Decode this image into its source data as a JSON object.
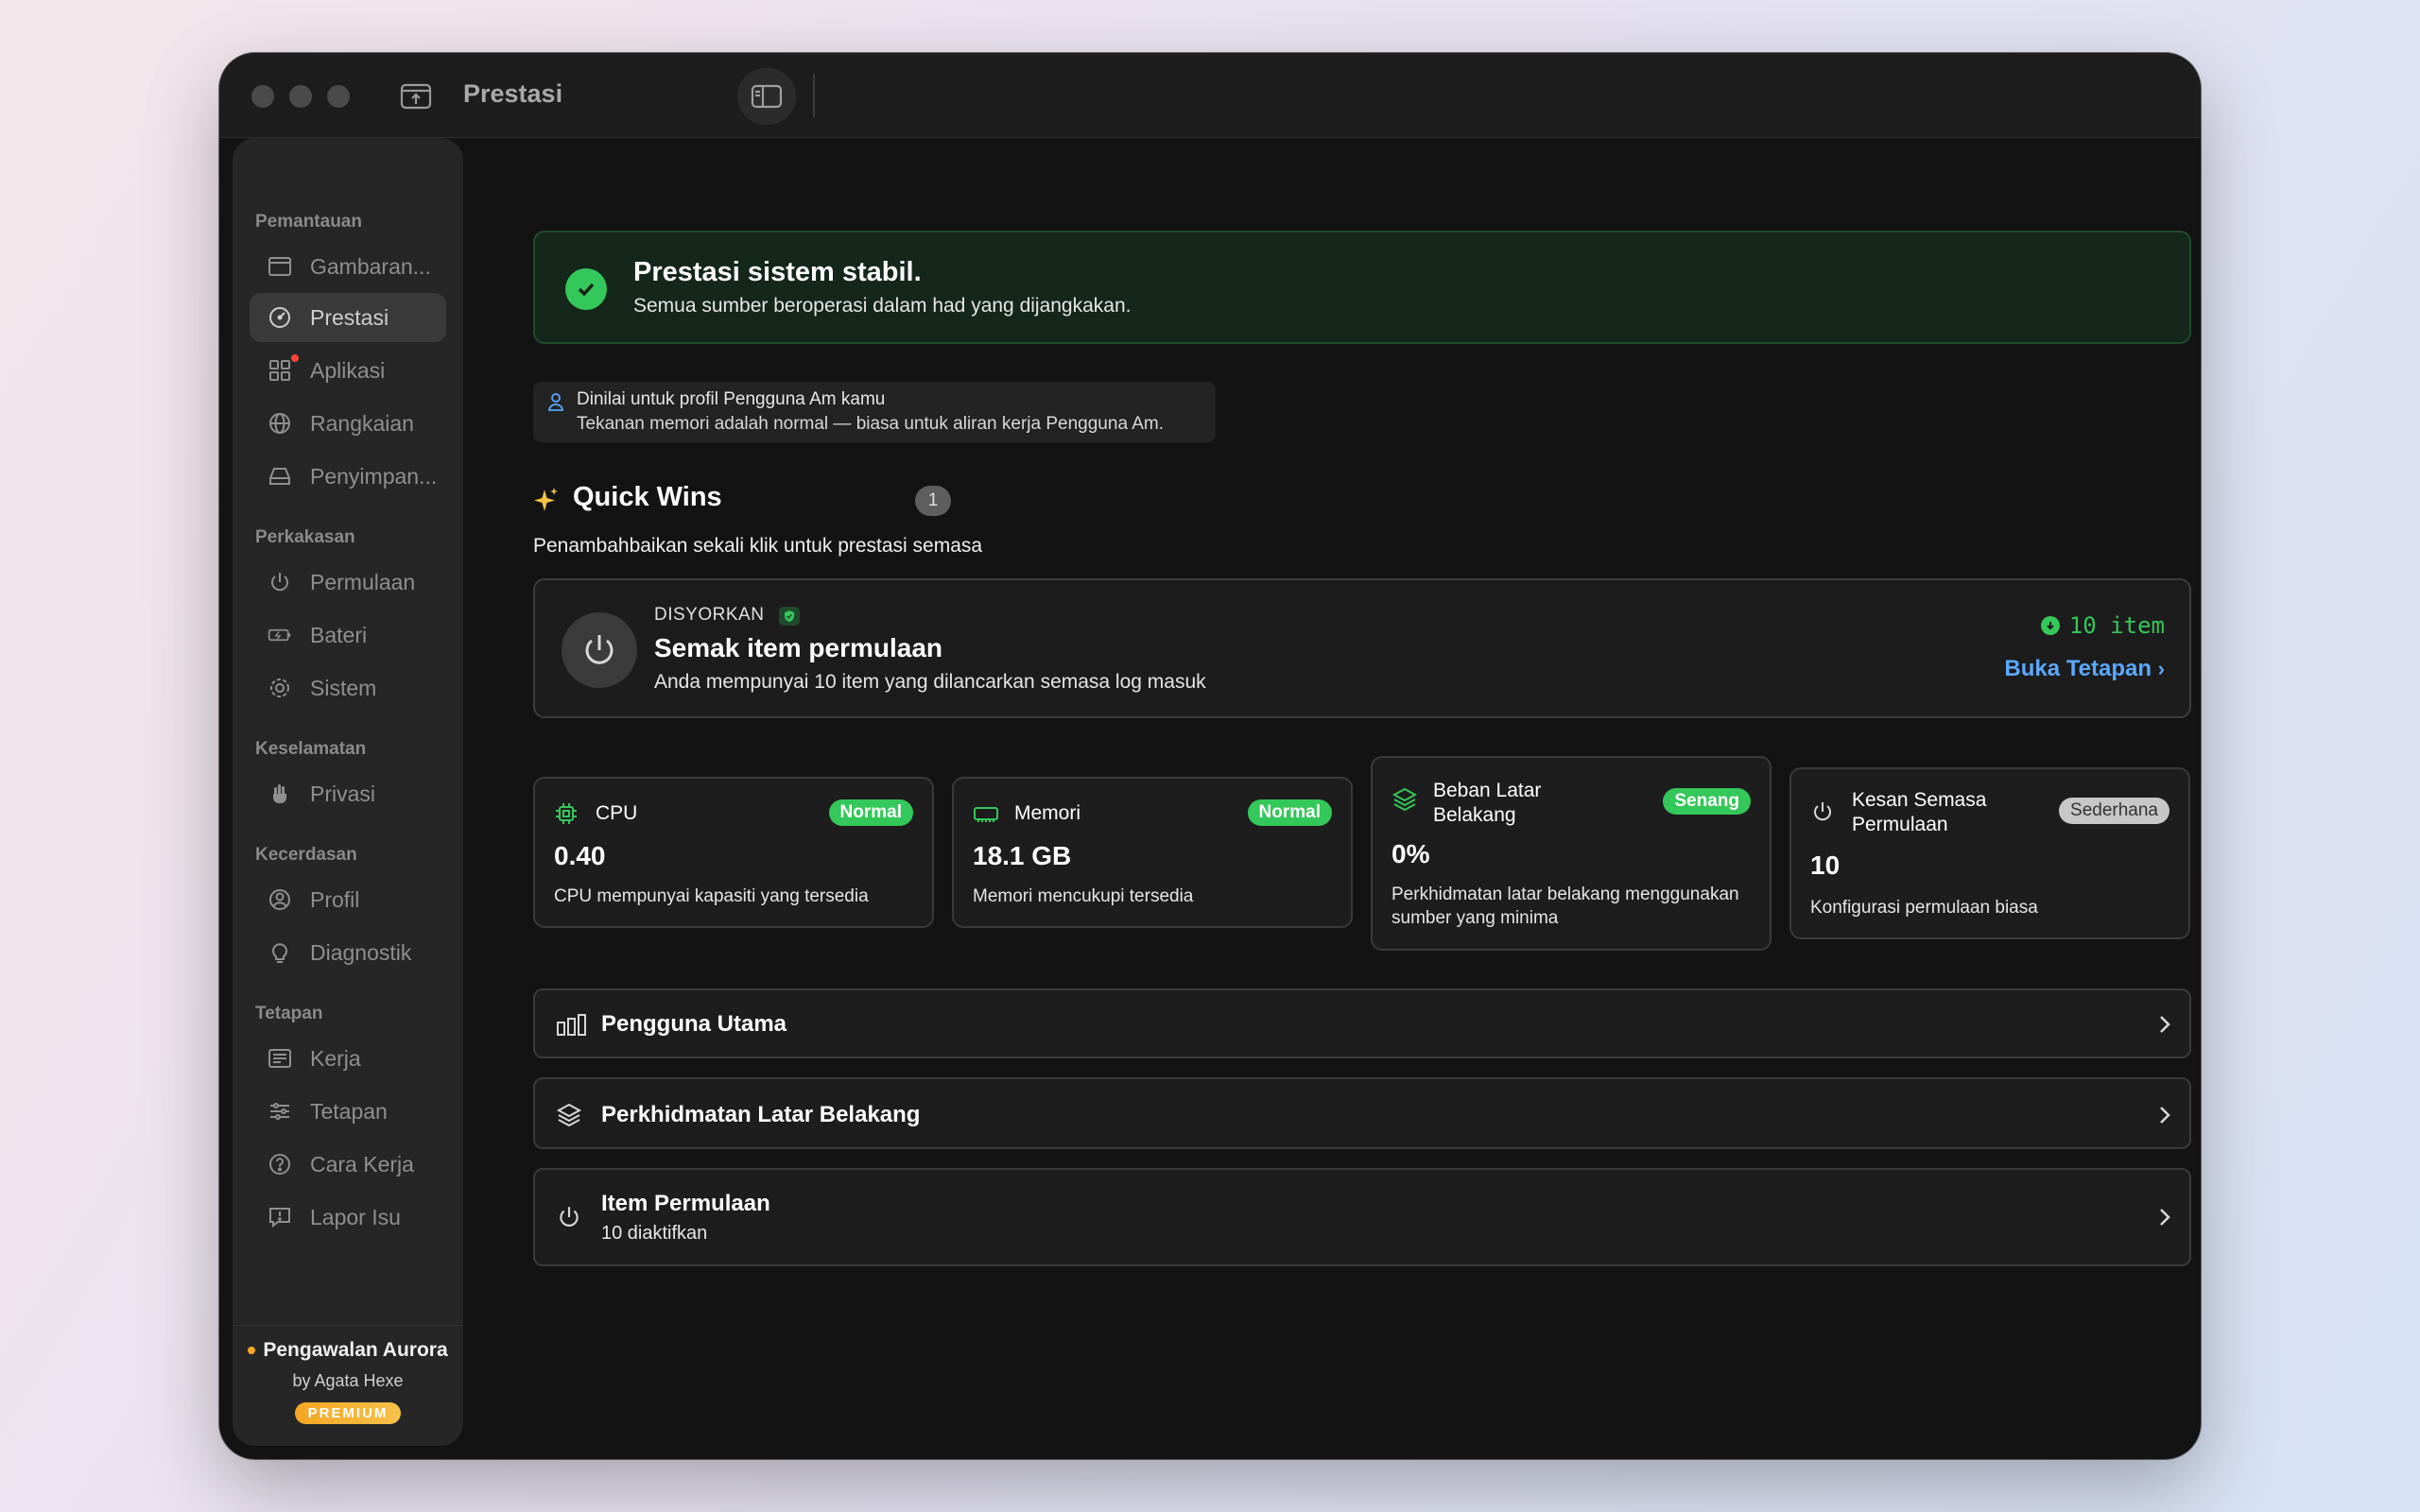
{
  "titlebar": {
    "title": "Prestasi"
  },
  "sidebar": {
    "sections": [
      {
        "label": "Pemantauan",
        "items": [
          {
            "label": "Gambaran...",
            "icon": "overview-icon"
          },
          {
            "label": "Prestasi",
            "icon": "gauge-icon",
            "active": true
          },
          {
            "label": "Aplikasi",
            "icon": "apps-grid-icon",
            "notification": true
          },
          {
            "label": "Rangkaian",
            "icon": "globe-icon"
          },
          {
            "label": "Penyimpan...",
            "icon": "drive-icon"
          }
        ]
      },
      {
        "label": "Perkakasan",
        "items": [
          {
            "label": "Permulaan",
            "icon": "power-icon"
          },
          {
            "label": "Bateri",
            "icon": "battery-icon"
          },
          {
            "label": "Sistem",
            "icon": "gear-icon"
          }
        ]
      },
      {
        "label": "Keselamatan",
        "items": [
          {
            "label": "Privasi",
            "icon": "hand-icon"
          }
        ]
      },
      {
        "label": "Kecerdasan",
        "items": [
          {
            "label": "Profil",
            "icon": "user-circle-icon"
          },
          {
            "label": "Diagnostik",
            "icon": "lightbulb-icon"
          }
        ]
      },
      {
        "label": "Tetapan",
        "items": [
          {
            "label": "Kerja",
            "icon": "list-icon"
          },
          {
            "label": "Tetapan",
            "icon": "sliders-icon"
          },
          {
            "label": "Cara Kerja",
            "icon": "help-icon"
          },
          {
            "label": "Lapor Isu",
            "icon": "report-icon"
          }
        ]
      }
    ],
    "footer": {
      "brand": "Pengawalan Aurora",
      "by": "by Agata Hexe",
      "badge": "PREMIUM"
    }
  },
  "banner": {
    "title": "Prestasi sistem stabil.",
    "subtitle": "Semua sumber beroperasi dalam had yang dijangkakan."
  },
  "profile_note": {
    "line1": "Dinilai untuk profil Pengguna Am kamu",
    "line2": "Tekanan memori adalah normal — biasa untuk aliran kerja Pengguna Am."
  },
  "quick_wins": {
    "title": "Quick Wins",
    "count": "1",
    "subtitle": "Penambahbaikan sekali klik untuk prestasi semasa",
    "card": {
      "tag": "DISYORKAN",
      "title": "Semak item permulaan",
      "description": "Anda mempunyai 10 item yang dilancarkan semasa log masuk",
      "items": "10 item",
      "action": "Buka Tetapan"
    }
  },
  "metrics": [
    {
      "name": "CPU",
      "badge": "Normal",
      "value": "0.40",
      "note": "CPU mempunyai kapasiti yang tersedia"
    },
    {
      "name": "Memori",
      "badge": "Normal",
      "value": "18.1 GB",
      "note": "Memori mencukupi tersedia"
    },
    {
      "name": "Beban Latar Belakang",
      "badge": "Senang",
      "value": "0%",
      "note": "Perkhidmatan latar belakang menggunakan sumber yang minima"
    },
    {
      "name": "Kesan Semasa Permulaan",
      "badge": "Sederhana",
      "value": "10",
      "note": "Konfigurasi permulaan biasa"
    }
  ],
  "rows": [
    {
      "label": "Pengguna Utama",
      "icon": "bar-chart-icon"
    },
    {
      "label": "Perkhidmatan Latar Belakang",
      "icon": "layers-icon"
    },
    {
      "label": "Item Permulaan",
      "sub": "10 diaktifkan",
      "icon": "power-icon"
    }
  ],
  "colors": {
    "accent_green": "#34c759",
    "link_blue": "#5ba8ff",
    "premium": "#f5a623"
  }
}
